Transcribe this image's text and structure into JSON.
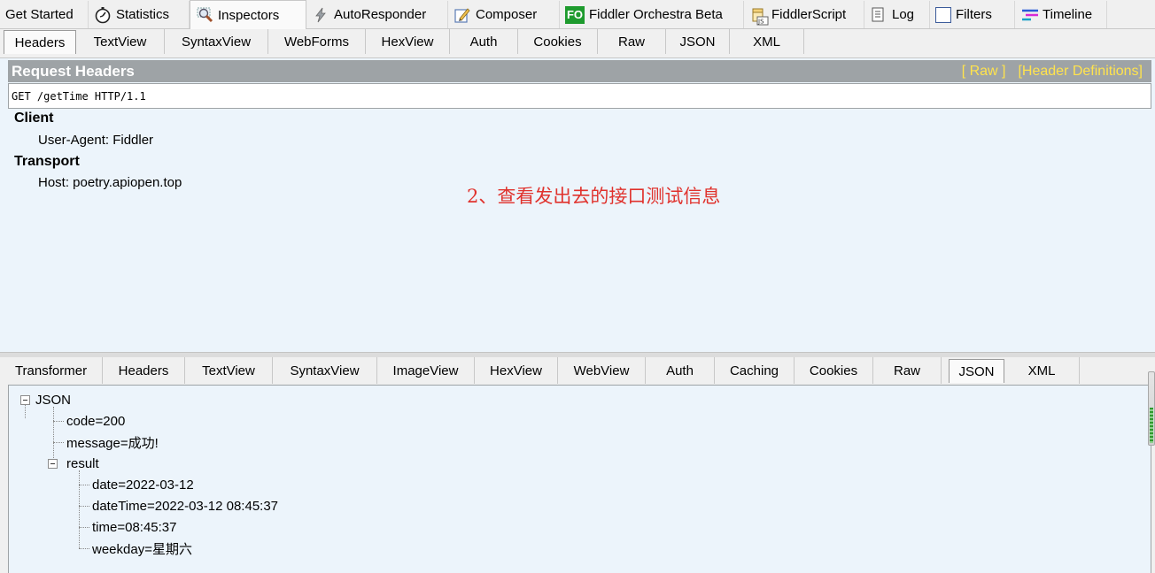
{
  "top_tabs": [
    {
      "label": "Get Started",
      "icon": ""
    },
    {
      "label": "Statistics",
      "icon": "stopwatch-icon"
    },
    {
      "label": "Inspectors",
      "icon": "inspector-magnifier-icon",
      "active": true
    },
    {
      "label": "AutoResponder",
      "icon": "lightning-icon"
    },
    {
      "label": "Composer",
      "icon": "pencil-compose-icon"
    },
    {
      "label": "Fiddler Orchestra Beta",
      "icon": "fo-icon",
      "icon_text": "FO"
    },
    {
      "label": "FiddlerScript",
      "icon": "js-script-icon"
    },
    {
      "label": "Log",
      "icon": "log-list-icon"
    },
    {
      "label": "Filters",
      "icon": "checkbox-icon"
    },
    {
      "label": "Timeline",
      "icon": "timeline-icon"
    }
  ],
  "request_tabs": [
    "Headers",
    "TextView",
    "SyntaxView",
    "WebForms",
    "HexView",
    "Auth",
    "Cookies",
    "Raw",
    "JSON",
    "XML"
  ],
  "request_active_tab": "Headers",
  "request_headers": {
    "title": "Request Headers",
    "links": [
      "[ Raw ]",
      "[Header Definitions]"
    ],
    "request_line": "GET /getTime HTTP/1.1",
    "groups": [
      {
        "name": "Client",
        "items": [
          "User-Agent: Fiddler"
        ]
      },
      {
        "name": "Transport",
        "items": [
          "Host: poetry.apiopen.top"
        ]
      }
    ]
  },
  "annotation": "2、查看发出去的接口测试信息",
  "response_tabs": [
    "Transformer",
    "Headers",
    "TextView",
    "SyntaxView",
    "ImageView",
    "HexView",
    "WebView",
    "Auth",
    "Caching",
    "Cookies",
    "Raw",
    "JSON",
    "XML"
  ],
  "response_active_tab": "JSON",
  "json_tree": {
    "root": "JSON",
    "code": "code=200",
    "message": "message=成功!",
    "result": "result",
    "date": "date=2022-03-12",
    "dateTime": "dateTime=2022-03-12 08:45:37",
    "time": "time=08:45:37",
    "weekday": "weekday=星期六"
  },
  "colors": {
    "panel_bg": "#ecf4fb",
    "header_bar": "#9ea3a6",
    "header_links": "#ffe34d",
    "annotation": "#e0322d",
    "fo_green": "#1e9b2e"
  }
}
